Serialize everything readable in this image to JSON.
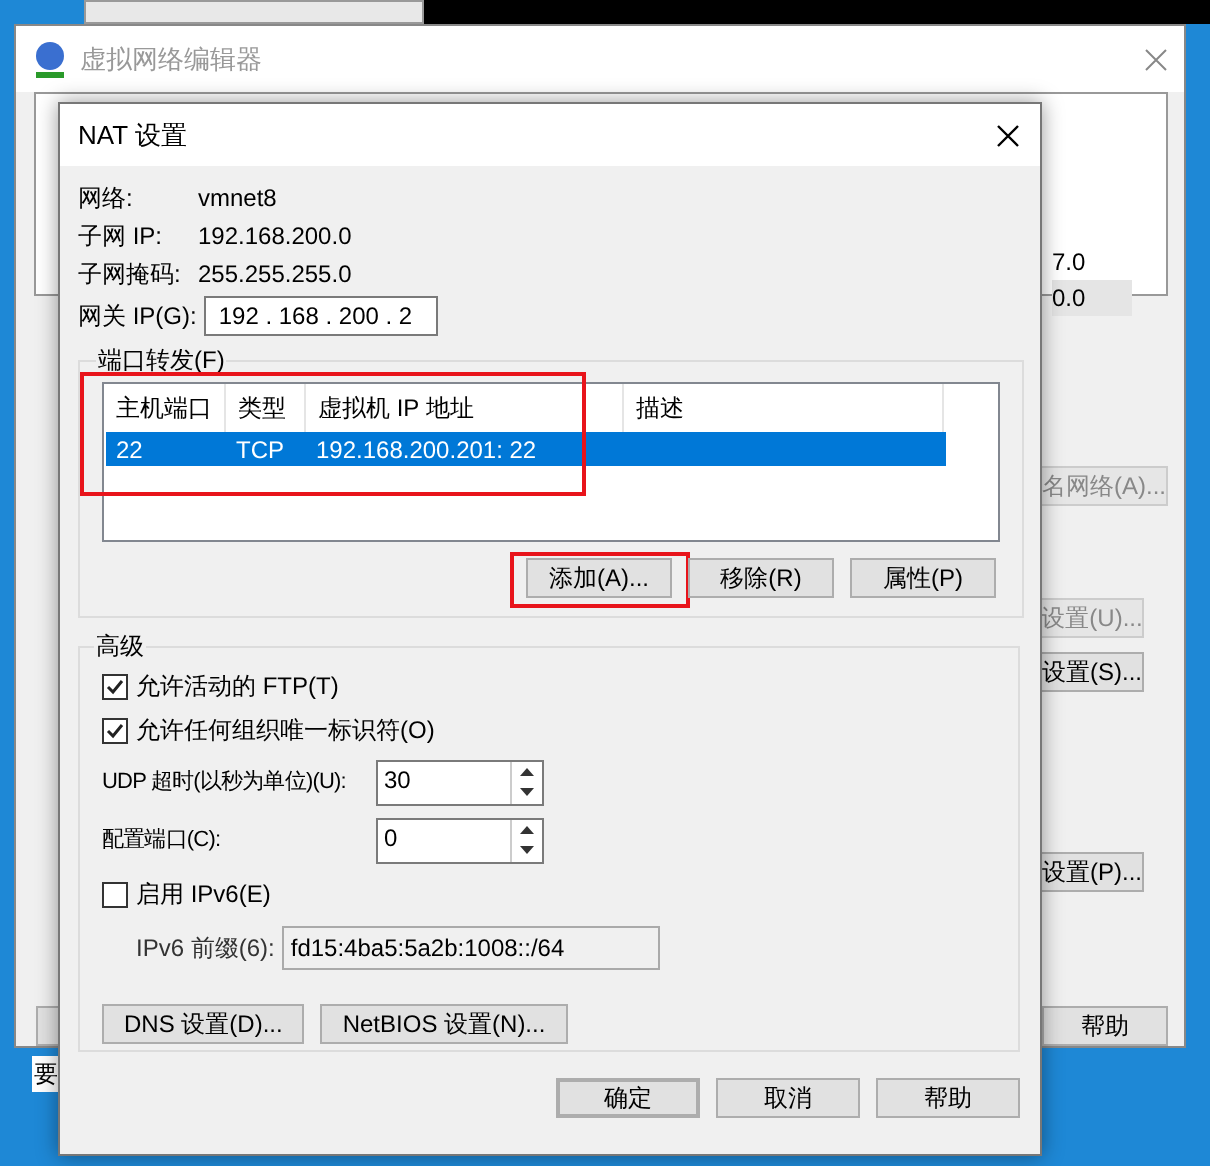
{
  "background_window": {
    "title": "虚拟网络编辑器",
    "list_values": [
      {
        "text": "7.0",
        "selected": false
      },
      {
        "text": "0.0",
        "selected": true
      }
    ],
    "buttons": [
      {
        "label": "名网络(A)...",
        "disabled": true
      },
      {
        "label": "设置(U)...",
        "disabled": true
      },
      {
        "label": "设置(S)...",
        "disabled": false
      },
      {
        "label": "设置(P)...",
        "disabled": false
      },
      {
        "label": "帮助",
        "disabled": false
      }
    ],
    "status_text": "要"
  },
  "dialog": {
    "title": "NAT 设置",
    "info": [
      {
        "label": "网络:",
        "value": "vmnet8"
      },
      {
        "label": "子网 IP:",
        "value": "192.168.200.0"
      },
      {
        "label": "子网掩码:",
        "value": "255.255.255.0"
      }
    ],
    "gateway": {
      "label": "网关 IP(G):",
      "value": "192 . 168 . 200 . 2"
    },
    "port_forwarding": {
      "label": "端口转发(F)",
      "columns": [
        "主机端口",
        "类型",
        "虚拟机 IP 地址",
        "描述"
      ],
      "rows": [
        {
          "cells": [
            "22",
            "TCP",
            "192.168.200.201: 22",
            ""
          ],
          "selected": true
        }
      ],
      "buttons": [
        {
          "label": "添加(A)...",
          "highlighted": true
        },
        {
          "label": "移除(R)",
          "highlighted": false
        },
        {
          "label": "属性(P)",
          "highlighted": false
        }
      ]
    },
    "advanced": {
      "label": "高级",
      "checkboxes": [
        {
          "label": "允许活动的 FTP(T)",
          "checked": true
        },
        {
          "label": "允许任何组织唯一标识符(O)",
          "checked": true
        }
      ],
      "spinners": [
        {
          "label": "UDP 超时(以秒为单位)(U):",
          "value": "30"
        },
        {
          "label": "配置端口(C):",
          "value": "0"
        }
      ],
      "ipv6": {
        "label": "启用 IPv6(E)",
        "checked": false
      },
      "prefix": {
        "label": "IPv6 前缀(6):",
        "value": "fd15:4ba5:5a2b:1008::/64",
        "disabled": true
      },
      "buttons": [
        "DNS 设置(D)...",
        "NetBIOS 设置(N)..."
      ]
    },
    "footer_buttons": [
      {
        "label": "确定",
        "default": true
      },
      {
        "label": "取消",
        "default": false
      },
      {
        "label": "帮助",
        "default": false
      }
    ]
  }
}
